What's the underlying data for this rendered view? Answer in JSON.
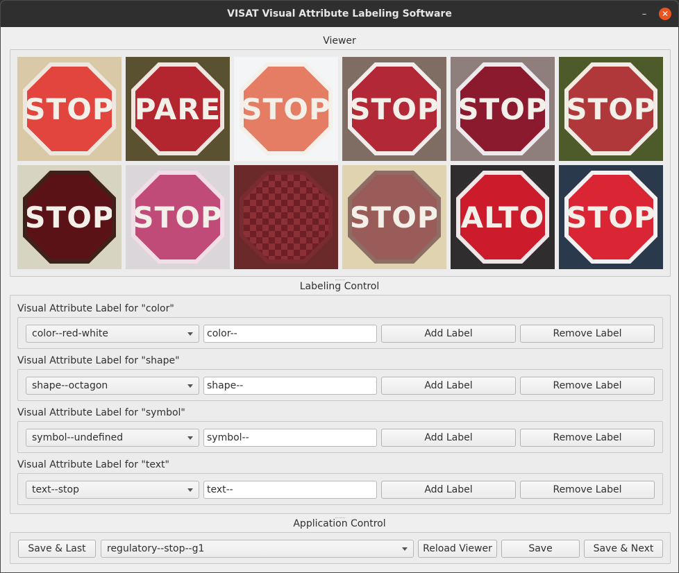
{
  "window": {
    "title": "VISAT Visual Attribute Labeling Software",
    "minimize_glyph": "–",
    "close_glyph": "✕"
  },
  "viewer": {
    "title": "Viewer",
    "images": [
      {
        "text": "STOP",
        "bg": "#d9c9a6",
        "border": "#efe6e0",
        "fill": "#e2453d"
      },
      {
        "text": "PARE",
        "bg": "#5a5130",
        "border": "#efe6e0",
        "fill": "#b3262f"
      },
      {
        "text": "STOP",
        "bg": "#f4f5f6",
        "border": "#f5efea",
        "fill": "#e47d64"
      },
      {
        "text": "STOP",
        "bg": "#7f6c62",
        "border": "#f2ecec",
        "fill": "#b22836"
      },
      {
        "text": "STOP",
        "bg": "#8f7f7c",
        "border": "#eee9ec",
        "fill": "#8c1a2e"
      },
      {
        "text": "STOP",
        "bg": "#4d5a2a",
        "border": "#f2ebe3",
        "fill": "#b0383a"
      },
      {
        "text": "STOP",
        "bg": "#d8d4c2",
        "border": "#40201b",
        "fill": "#5a1216"
      },
      {
        "text": "STOP",
        "bg": "#dad6da",
        "border": "#f2dce6",
        "fill": "#c04a78"
      },
      {
        "text": "",
        "bg": "#6a2a2a",
        "border": "#7a2b2e",
        "fill": "#8a3036"
      },
      {
        "text": "STOP",
        "bg": "#e0d4b0",
        "border": "#8e6d65",
        "fill": "#9a5c58"
      },
      {
        "text": "ALTO",
        "bg": "#2f2d2e",
        "border": "#f0e6e8",
        "fill": "#cc1c2c"
      },
      {
        "text": "STOP",
        "bg": "#2a3a4c",
        "border": "#f4f1f3",
        "fill": "#d92534"
      }
    ]
  },
  "labeling": {
    "title": "Labeling Control",
    "add_label": "Add Label",
    "remove_label": "Remove Label",
    "attributes": [
      {
        "label": "Visual Attribute Label for \"color\"",
        "selected": "color--red-white",
        "input": "color--"
      },
      {
        "label": "Visual Attribute Label for \"shape\"",
        "selected": "shape--octagon",
        "input": "shape--"
      },
      {
        "label": "Visual Attribute Label for \"symbol\"",
        "selected": "symbol--undefined",
        "input": "symbol--"
      },
      {
        "label": "Visual Attribute Label for \"text\"",
        "selected": "text--stop",
        "input": "text--"
      }
    ]
  },
  "application": {
    "title": "Application Control",
    "save_last": "Save & Last",
    "class_selected": "regulatory--stop--g1",
    "reload_viewer": "Reload Viewer",
    "save": "Save",
    "save_next": "Save & Next"
  }
}
